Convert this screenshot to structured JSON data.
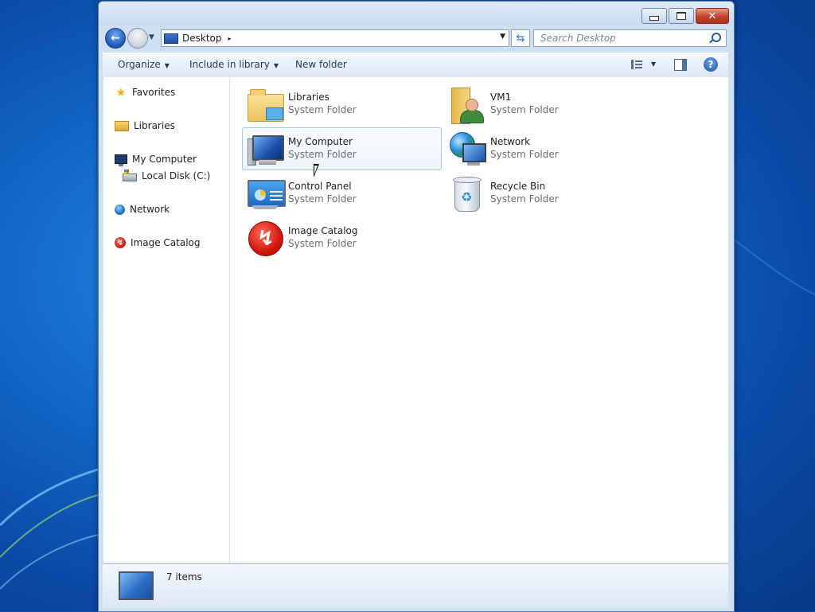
{
  "window": {
    "caption_buttons": {
      "minimize": "minimize-icon",
      "maximize": "maximize-icon",
      "close": "close-icon"
    }
  },
  "navigation": {
    "back_icon": "back-arrow-icon",
    "forward_icon": "forward-arrow-icon",
    "address": {
      "icon": "desktop-icon",
      "path": "Desktop",
      "separator": "▸"
    },
    "refresh_icon": "refresh-icon",
    "search": {
      "placeholder": "Search Desktop",
      "icon": "search-icon"
    }
  },
  "toolbar": {
    "organize_label": "Organize",
    "include_label": "Include in library",
    "new_folder_label": "New folder",
    "views_icon": "views-icon",
    "preview_icon": "preview-pane-icon",
    "help_icon": "help-icon",
    "help_glyph": "?"
  },
  "nav_pane": {
    "items": [
      {
        "label": "Favorites",
        "icon": "star-icon"
      },
      {
        "label": "Libraries",
        "icon": "libraries-icon"
      },
      {
        "label": "My Computer",
        "icon": "computer-icon"
      },
      {
        "label": "Local Disk (C:)",
        "icon": "disk-icon"
      },
      {
        "label": "Network",
        "icon": "network-icon"
      },
      {
        "label": "Image Catalog",
        "icon": "image-catalog-icon"
      }
    ]
  },
  "files": {
    "items": [
      {
        "name": "Libraries",
        "type": "System Folder",
        "icon": "libraries-folder-icon",
        "selected": false
      },
      {
        "name": "VM1",
        "type": "System Folder",
        "icon": "user-folder-icon",
        "selected": false
      },
      {
        "name": "My Computer",
        "type": "System Folder",
        "icon": "computer-icon",
        "selected": true
      },
      {
        "name": "Network",
        "type": "System Folder",
        "icon": "network-icon",
        "selected": false
      },
      {
        "name": "Control Panel",
        "type": "System Folder",
        "icon": "control-panel-icon",
        "selected": false
      },
      {
        "name": "Recycle Bin",
        "type": "System Folder",
        "icon": "recycle-bin-icon",
        "selected": false
      },
      {
        "name": "Image Catalog",
        "type": "System Folder",
        "icon": "image-catalog-icon",
        "selected": false
      }
    ]
  },
  "status_bar": {
    "item_count": "7 items",
    "icon": "desktop-icon"
  },
  "colors": {
    "desktop_blue": "#1268c8",
    "window_frame": "#cfe0f3",
    "selection_border": "#a8c8ea",
    "close_button": "#c3432b",
    "secondary_text": "#6d6d6d"
  }
}
